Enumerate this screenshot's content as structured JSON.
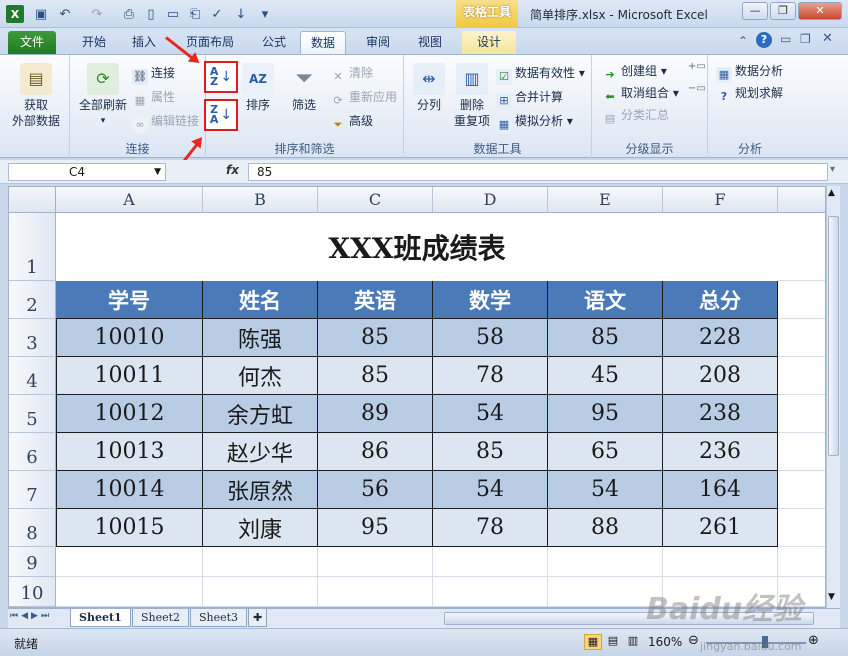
{
  "window": {
    "title": "简单排序.xlsx - Microsoft Excel",
    "context_tools": "表格工具",
    "app_icon": "excel-icon"
  },
  "tabs": [
    {
      "label": "文件"
    },
    {
      "label": "开始"
    },
    {
      "label": "插入"
    },
    {
      "label": "页面布局"
    },
    {
      "label": "公式"
    },
    {
      "label": "数据"
    },
    {
      "label": "审阅"
    },
    {
      "label": "视图"
    },
    {
      "label": "设计"
    }
  ],
  "ribbon": {
    "get_external": {
      "line1": "获取",
      "line2": "外部数据"
    },
    "connections": {
      "refresh_all": "全部刷新",
      "connect": "连接",
      "properties": "属性",
      "edit_links": "编辑链接",
      "group_label": "连接"
    },
    "sort_filter": {
      "sort": "排序",
      "filter": "筛选",
      "clear": "清除",
      "reapply": "重新应用",
      "advanced": "高级",
      "group_label": "排序和筛选",
      "sort_asc_top": "A",
      "sort_asc_bottom": "Z",
      "sort_desc_top": "Z",
      "sort_desc_bottom": "A"
    },
    "data_tools": {
      "text_to_columns": "分列",
      "remove_dup_line1": "删除",
      "remove_dup_line2": "重复项",
      "validation": "数据有效性",
      "consolidate": "合并计算",
      "what_if": "模拟分析",
      "group_label": "数据工具"
    },
    "outline": {
      "group": "创建组",
      "ungroup": "取消组合",
      "subtotal": "分类汇总",
      "group_label": "分级显示"
    },
    "analysis": {
      "data_analysis": "数据分析",
      "solver": "规划求解",
      "group_label": "分析"
    }
  },
  "formula_bar": {
    "name_box": "C4",
    "fx": "fx",
    "value": "85"
  },
  "sheet": {
    "columns": [
      "A",
      "B",
      "C",
      "D",
      "E",
      "F"
    ],
    "rows": [
      "1",
      "2",
      "3",
      "4",
      "5",
      "6",
      "7",
      "8",
      "9",
      "10"
    ],
    "title": "XXX班成绩表",
    "headers": [
      "学号",
      "姓名",
      "英语",
      "数学",
      "语文",
      "总分"
    ],
    "data": [
      [
        "10010",
        "陈强",
        "85",
        "58",
        "85",
        "228"
      ],
      [
        "10011",
        "何杰",
        "85",
        "78",
        "45",
        "208"
      ],
      [
        "10012",
        "余方虹",
        "89",
        "54",
        "95",
        "238"
      ],
      [
        "10013",
        "赵少华",
        "86",
        "85",
        "65",
        "236"
      ],
      [
        "10014",
        "张原然",
        "56",
        "54",
        "54",
        "164"
      ],
      [
        "10015",
        "刘康",
        "95",
        "78",
        "88",
        "261"
      ]
    ]
  },
  "sheet_tabs": [
    "Sheet1",
    "Sheet2",
    "Sheet3"
  ],
  "status": {
    "ready": "就绪",
    "zoom": "160%"
  },
  "watermark": {
    "brand": "Baidu经验",
    "url": "jingyan.baidu.com"
  },
  "colors": {
    "header_fill": "#4a7ab8",
    "band_dark": "#b8cce4",
    "band_light": "#dce6f1",
    "annotation_red": "#e21b1b"
  }
}
